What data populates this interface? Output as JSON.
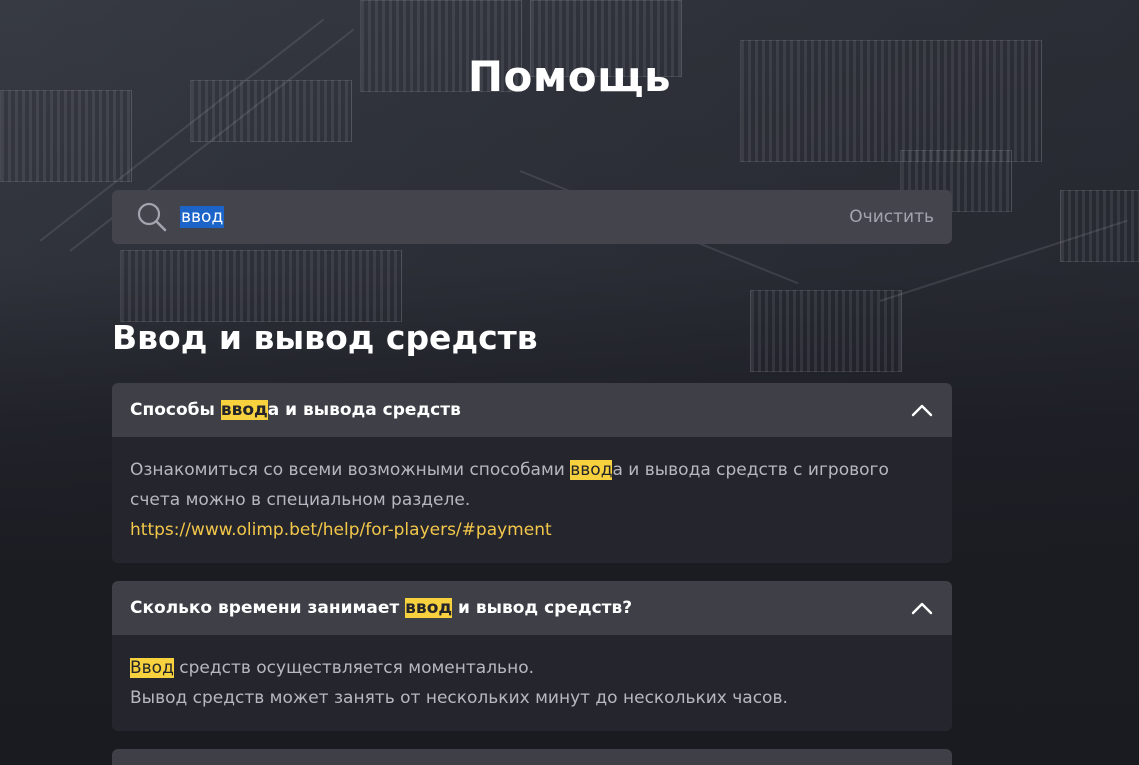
{
  "page": {
    "title": "Помощь"
  },
  "search": {
    "value": "ввод",
    "clear_label": "Очистить"
  },
  "section": {
    "title": "Ввод и вывод средств"
  },
  "faq": [
    {
      "question_before": "Способы ",
      "question_match": "ввод",
      "question_after": "а и вывода средств",
      "answer_before": "Ознакомиться со всеми возможными способами ",
      "answer_match": "ввод",
      "answer_after": "а и вывода средств с игрового счета можно в специальном разделе.",
      "link": "https://www.olimp.bet/help/for-players/#payment"
    },
    {
      "question_before": "Сколько времени занимает ",
      "question_match": "ввод",
      "question_after": " и вывод средств?",
      "answer_match": "Ввод",
      "answer_line1_after": " средств осуществляется моментально.",
      "answer_line2": "Вывод средств может занять от нескольких минут до нескольких часов."
    }
  ],
  "colors": {
    "highlight": "#f7d23e",
    "link": "#f3c74a",
    "selection": "#1c64c8"
  },
  "icons": {
    "search": "search-icon",
    "chevron": "chevron-up-icon"
  }
}
